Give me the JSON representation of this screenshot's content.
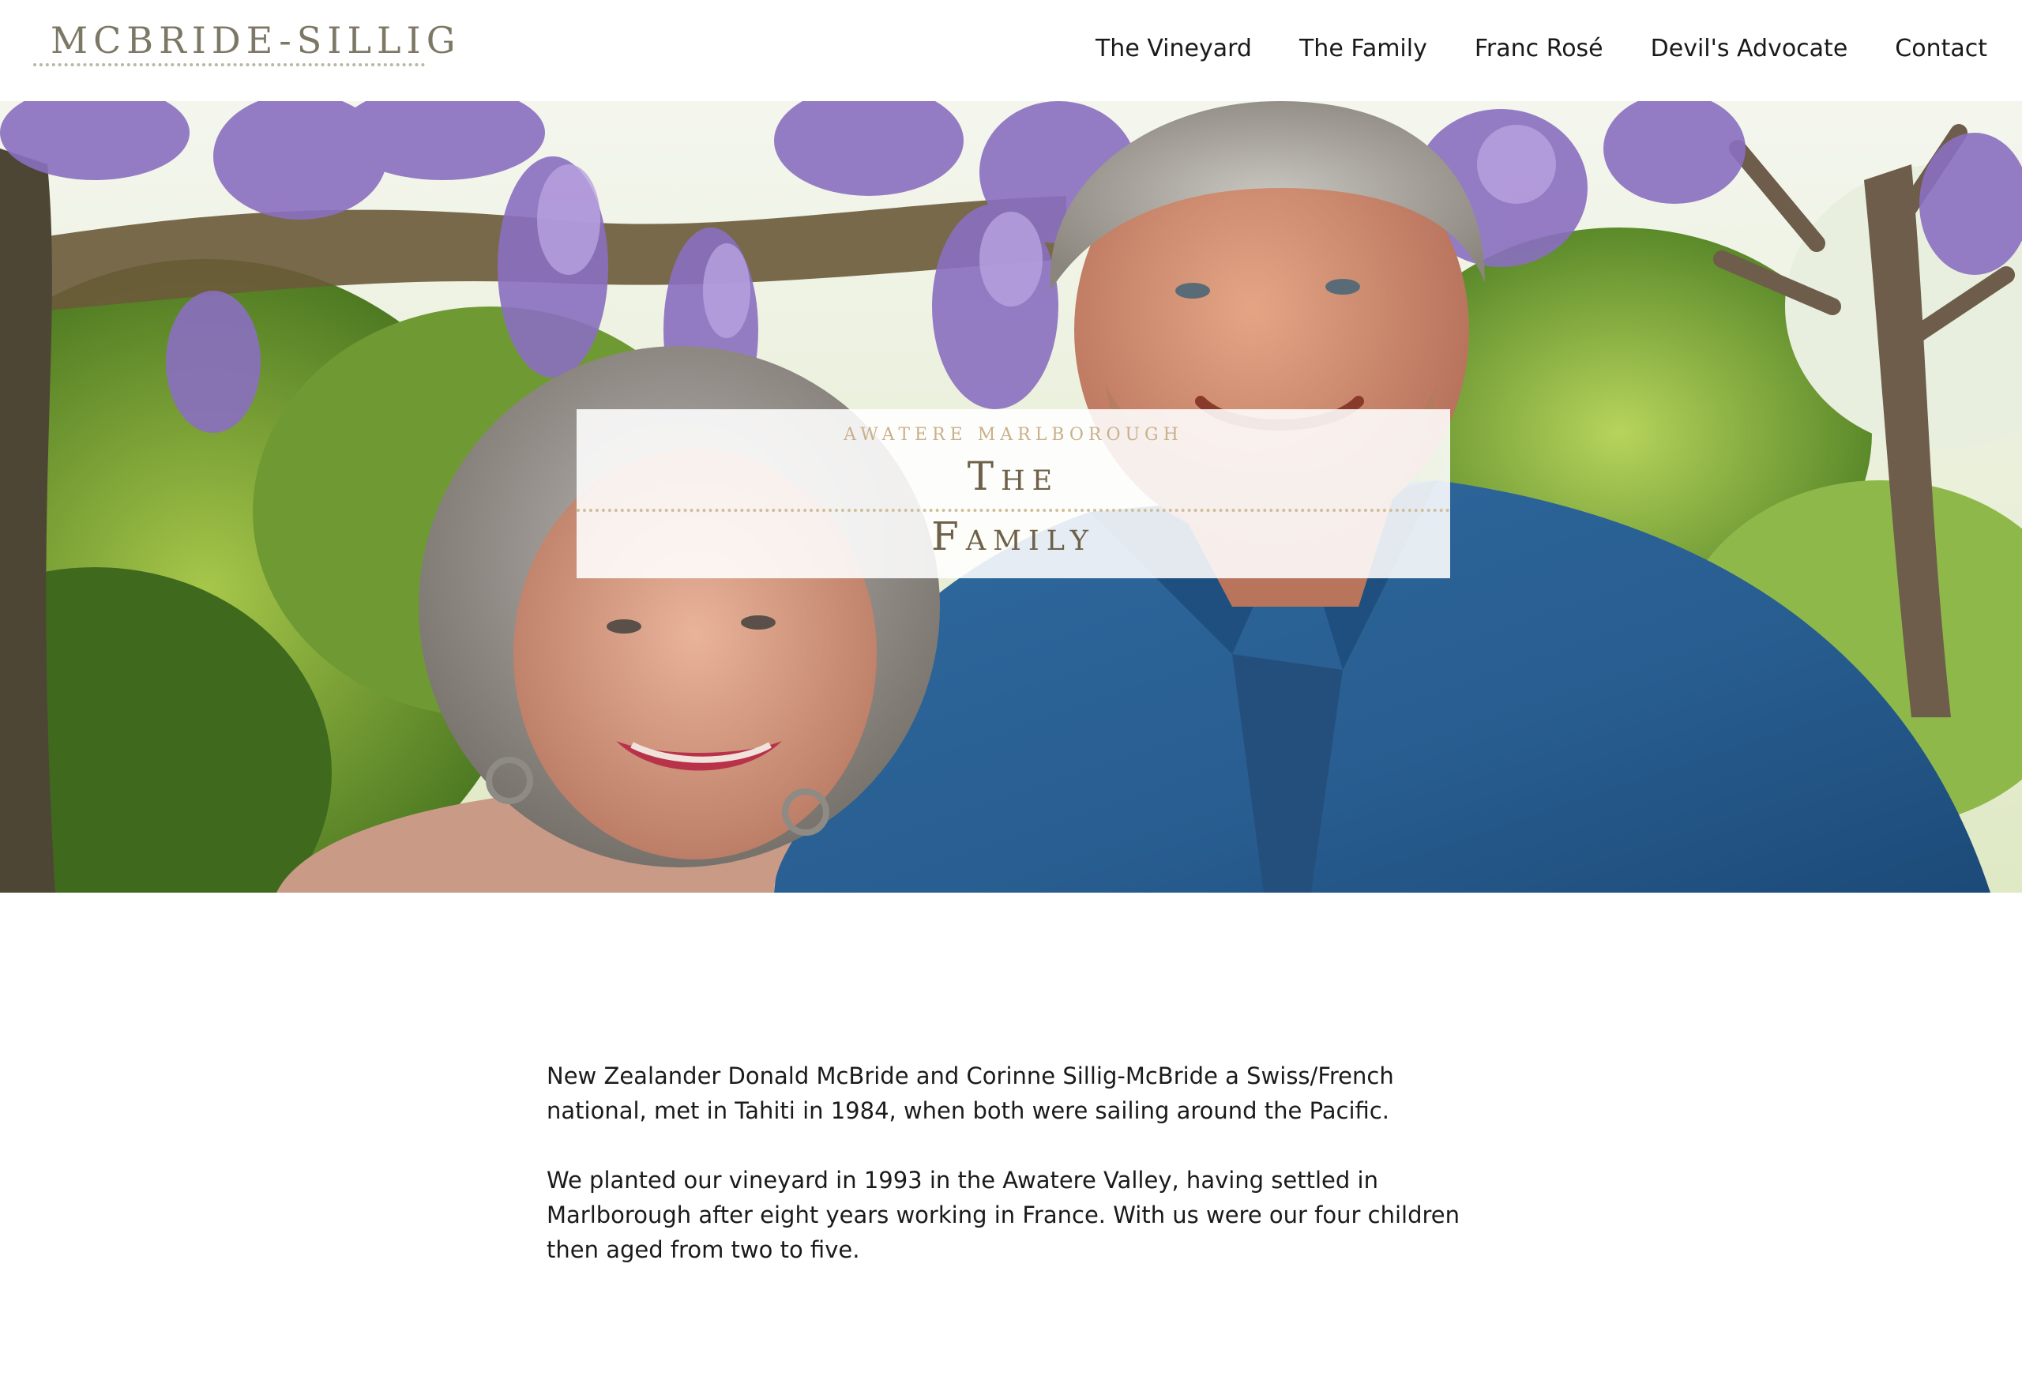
{
  "header": {
    "logo_text": "McBride-Sillig",
    "nav": [
      {
        "label": "The Vineyard"
      },
      {
        "label": "The Family"
      },
      {
        "label": "Franc Rosé"
      },
      {
        "label": "Devil's Advocate"
      },
      {
        "label": "Contact"
      }
    ]
  },
  "hero": {
    "kicker": "AWATERE   MARLBOROUGH",
    "title_line1": "The",
    "title_line2": "Family"
  },
  "content": {
    "paragraphs": [
      "New Zealander Donald McBride and Corinne Sillig-McBride a Swiss/French national, met in Tahiti in 1984, when both were sailing around the Pacific.",
      "We planted our vineyard in 1993 in the Awatere Valley, having settled in Marlborough after eight years working in France. With us were our four children then aged from two to five."
    ]
  },
  "colors": {
    "logo": "#7d7866",
    "nav_text": "#1a1a1a",
    "banner_kicker": "#c9b08b",
    "banner_title": "#6e6049"
  }
}
